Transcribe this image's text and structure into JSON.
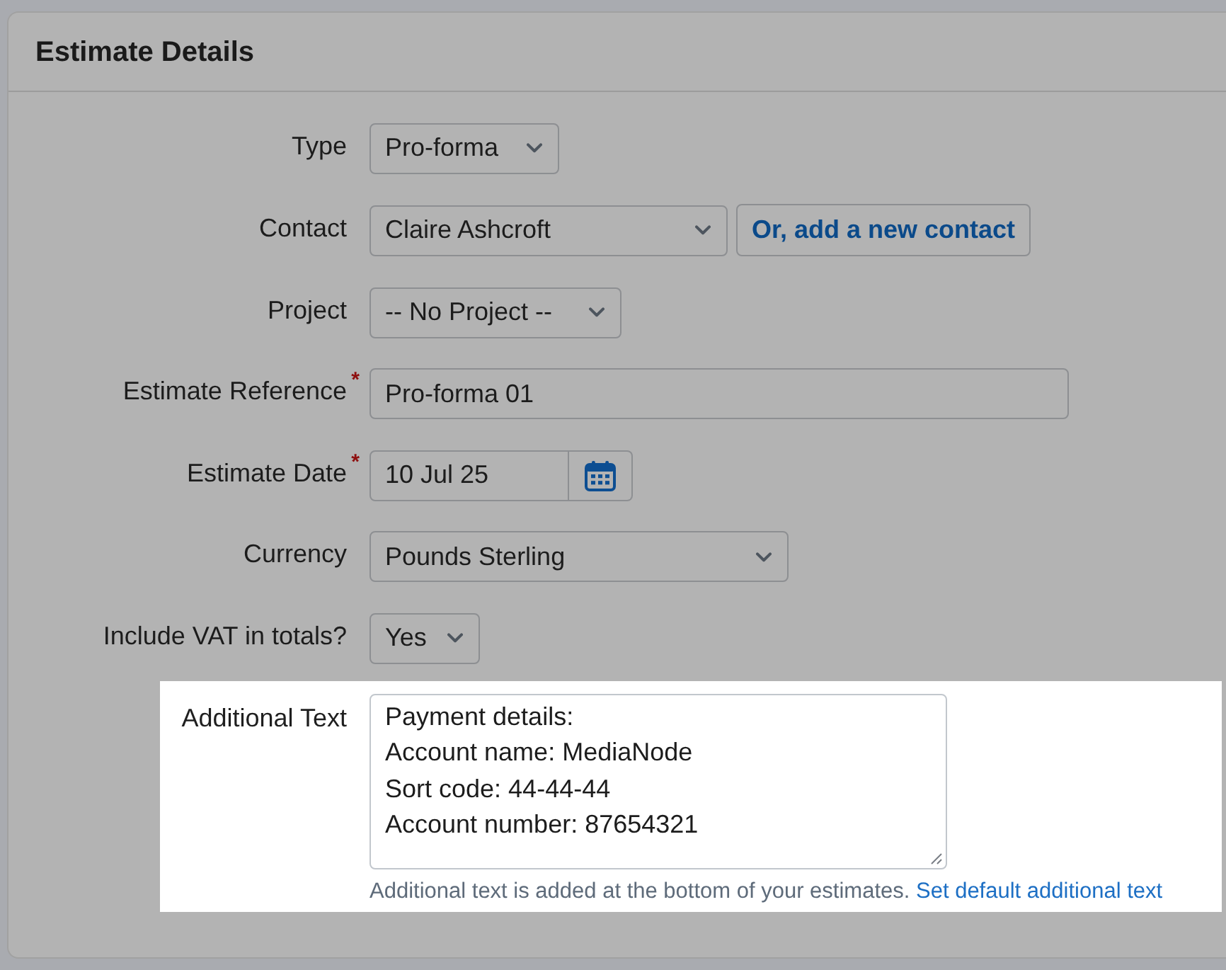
{
  "panel": {
    "title": "Estimate Details"
  },
  "fields": [
    {
      "kind": "select",
      "label": "Type",
      "value": "Pro-forma",
      "spotlight": false
    },
    {
      "kind": "select",
      "label": "Contact",
      "value": "Claire Ashcroft",
      "button": "Or, add a new contact",
      "spotlight": false
    },
    {
      "kind": "select",
      "label": "Project",
      "value": "-- No Project --",
      "spotlight": false
    },
    {
      "kind": "text",
      "label": "Estimate Reference",
      "required_mark": "*",
      "value": "Pro-forma 01",
      "spotlight": false
    },
    {
      "kind": "date",
      "label": "Estimate Date",
      "required_mark": "*",
      "value": "10 Jul 25",
      "spotlight": false
    },
    {
      "kind": "select",
      "label": "Currency",
      "value": "Pounds Sterling",
      "spotlight": false
    },
    {
      "kind": "select",
      "label": "Include VAT in totals?",
      "value": "Yes",
      "spotlight": false
    },
    {
      "kind": "textarea",
      "label": "Additional Text",
      "value": "Payment details:\nAccount name: MediaNode\nSort code: 44-44-44\nAccount number: 87654321",
      "help": "Additional text is added at the bottom of your estimates.",
      "help_link": "Set default additional text",
      "spotlight": true
    }
  ]
}
